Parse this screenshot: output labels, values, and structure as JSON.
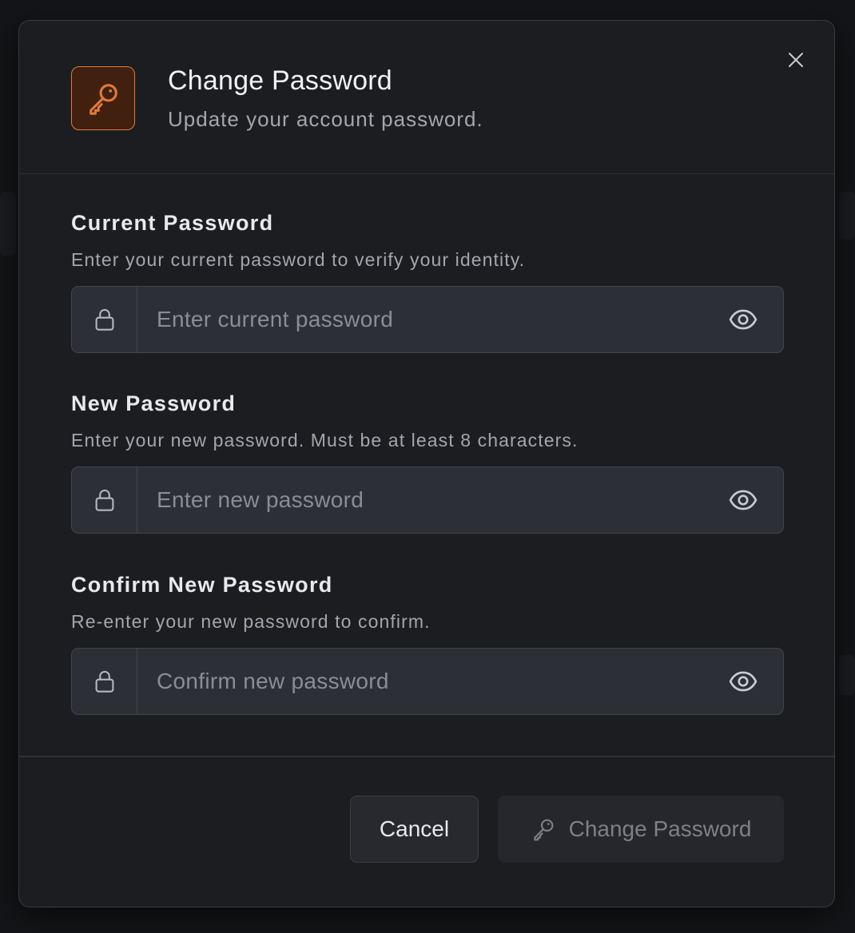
{
  "dialog": {
    "title": "Change Password",
    "subtitle": "Update your account password.",
    "icon": "key-icon",
    "close_icon": "close-icon"
  },
  "fields": [
    {
      "label": "Current Password",
      "help": "Enter your current password to verify your identity.",
      "placeholder": "Enter current password",
      "value": ""
    },
    {
      "label": "New Password",
      "help": "Enter your new password. Must be at least 8 characters.",
      "placeholder": "Enter new password",
      "value": ""
    },
    {
      "label": "Confirm New Password",
      "help": "Re-enter your new password to confirm.",
      "placeholder": "Confirm new password",
      "value": ""
    }
  ],
  "actions": {
    "cancel_label": "Cancel",
    "submit_label": "Change Password",
    "submit_disabled": true
  },
  "colors": {
    "accent": "#e07a3a",
    "accent_bg": "#41200f",
    "dialog_bg": "#1c1d21",
    "input_bg": "#2d2f36"
  }
}
